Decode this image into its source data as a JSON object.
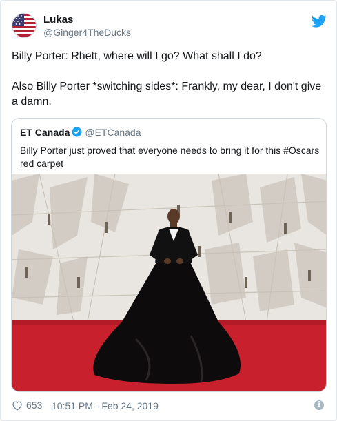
{
  "user": {
    "name": "Lukas",
    "handle": "@Ginger4TheDucks",
    "avatar_icon": "us-flag-avatar"
  },
  "tweet": {
    "text": "Billy Porter: Rhett, where will I go? What shall I do?\n\nAlso Billy Porter *switching sides*: Frankly, my dear, I don't give a damn."
  },
  "quoted": {
    "name": "ET Canada",
    "handle": "@ETCanada",
    "text": "Billy Porter just proved that everyone needs to bring it for this #Oscars red carpet",
    "image_icon": "red-carpet-photo"
  },
  "footer": {
    "likes": "653",
    "timestamp": "10:51 PM - Feb 24, 2019"
  },
  "colors": {
    "brand": "#1da1f2",
    "secondary_text": "#657786",
    "carpet": "#c8202d"
  }
}
